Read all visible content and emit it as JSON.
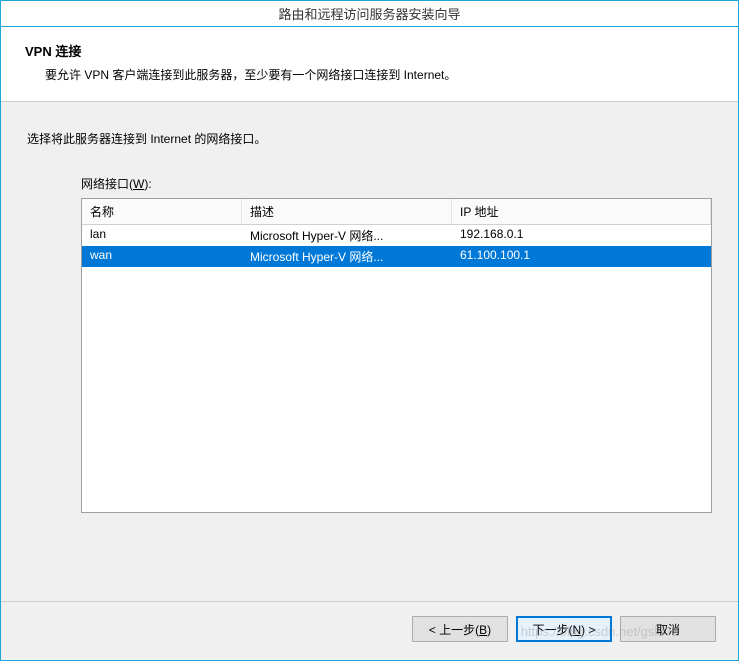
{
  "titlebar": "路由和远程访问服务器安装向导",
  "header": {
    "title": "VPN 连接",
    "desc": "要允许 VPN 客户端连接到此服务器，至少要有一个网络接口连接到 Internet。"
  },
  "content": {
    "instruction": "选择将此服务器连接到 Internet 的网络接口。",
    "list_label_prefix": "网络接口(",
    "list_label_accel": "W",
    "list_label_suffix": "):",
    "columns": {
      "name": "名称",
      "desc": "描述",
      "ip": "IP 地址"
    },
    "rows": [
      {
        "name": "lan",
        "desc": "Microsoft Hyper-V 网络...",
        "ip": "192.168.0.1",
        "selected": false
      },
      {
        "name": "wan",
        "desc": "Microsoft Hyper-V 网络...",
        "ip": "61.100.100.1",
        "selected": true
      }
    ]
  },
  "buttons": {
    "back_prefix": "< 上一步(",
    "back_accel": "B",
    "back_suffix": ")",
    "next_prefix": "下一步(",
    "next_accel": "N",
    "next_suffix": ") >",
    "cancel": "取消"
  },
  "watermark": "https://blog.csdn.net/gsl371"
}
